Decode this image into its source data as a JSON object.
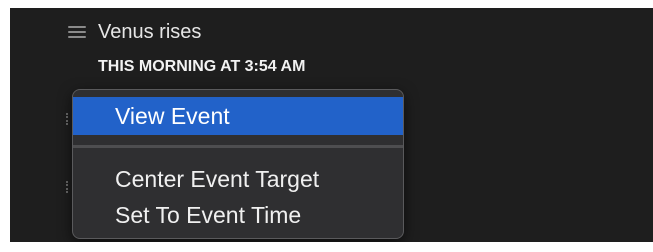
{
  "event": {
    "icon": "list-icon",
    "title": "Venus rises",
    "time": "THIS MORNING AT 3:54 AM"
  },
  "context_menu": {
    "items": [
      {
        "label": "View Event",
        "highlighted": true
      },
      {
        "label": "Center Event Target",
        "highlighted": false
      },
      {
        "label": "Set To Event Time",
        "highlighted": false
      }
    ]
  },
  "colors": {
    "background": "#1e1e1e",
    "menu_background": "#2f2f31",
    "highlight": "#2262c9",
    "text": "#f0f0f0"
  }
}
